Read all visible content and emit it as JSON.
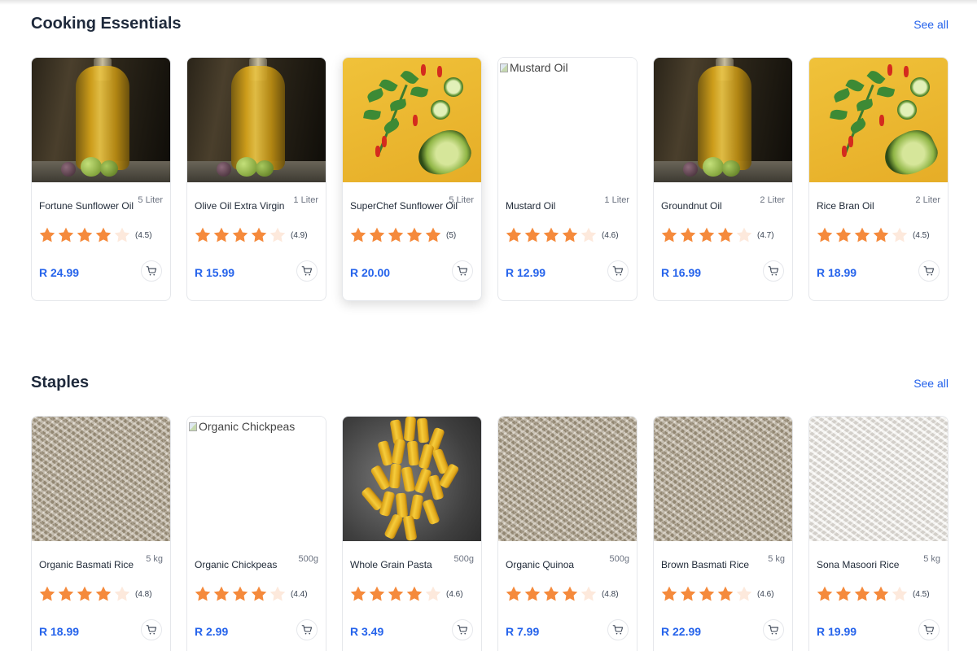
{
  "sections": [
    {
      "title": "Cooking Essentials",
      "see_all": "See all",
      "products": [
        {
          "name": "Fortune Sunflower Oil",
          "size": "5 Liter",
          "rating": 4.5,
          "rating_label": "(4.5)",
          "price": "R 24.99",
          "image": "oil"
        },
        {
          "name": "Olive Oil Extra Virgin",
          "size": "1 Liter",
          "rating": 4.9,
          "rating_label": "(4.9)",
          "price": "R 15.99",
          "image": "oil"
        },
        {
          "name": "SuperChef Sunflower Oil",
          "size": "5 Liter",
          "rating": 5,
          "rating_label": "(5)",
          "price": "R 20.00",
          "image": "veg"
        },
        {
          "name": "Mustard Oil",
          "size": "1 Liter",
          "rating": 4.6,
          "rating_label": "(4.6)",
          "price": "R 12.99",
          "image": "broken",
          "image_alt": "Mustard Oil"
        },
        {
          "name": "Groundnut Oil",
          "size": "2 Liter",
          "rating": 4.7,
          "rating_label": "(4.7)",
          "price": "R 16.99",
          "image": "oil"
        },
        {
          "name": "Rice Bran Oil",
          "size": "2 Liter",
          "rating": 4.5,
          "rating_label": "(4.5)",
          "price": "R 18.99",
          "image": "veg"
        }
      ]
    },
    {
      "title": "Staples",
      "see_all": "See all",
      "products": [
        {
          "name": "Organic Basmati Rice",
          "size": "5 kg",
          "rating": 4.8,
          "rating_label": "(4.8)",
          "price": "R 18.99",
          "image": "rice"
        },
        {
          "name": "Organic Chickpeas",
          "size": "500g",
          "rating": 4.4,
          "rating_label": "(4.4)",
          "price": "R 2.99",
          "image": "broken",
          "image_alt": "Organic Chickpeas"
        },
        {
          "name": "Whole Grain Pasta",
          "size": "500g",
          "rating": 4.6,
          "rating_label": "(4.6)",
          "price": "R 3.49",
          "image": "pasta"
        },
        {
          "name": "Organic Quinoa",
          "size": "500g",
          "rating": 4.8,
          "rating_label": "(4.8)",
          "price": "R 7.99",
          "image": "rice"
        },
        {
          "name": "Brown Basmati Rice",
          "size": "5 kg",
          "rating": 4.6,
          "rating_label": "(4.6)",
          "price": "R 22.99",
          "image": "rice"
        },
        {
          "name": "Sona Masoori Rice",
          "size": "5 kg",
          "rating": 4.5,
          "rating_label": "(4.5)",
          "price": "R 19.99",
          "image": "rice-white"
        }
      ]
    }
  ],
  "colors": {
    "accent": "#2563eb",
    "star_full": "#f58a3c",
    "star_empty": "#fde9dc",
    "title": "#1e293b"
  },
  "icons": {
    "star": "star-icon",
    "cart": "cart-icon"
  }
}
